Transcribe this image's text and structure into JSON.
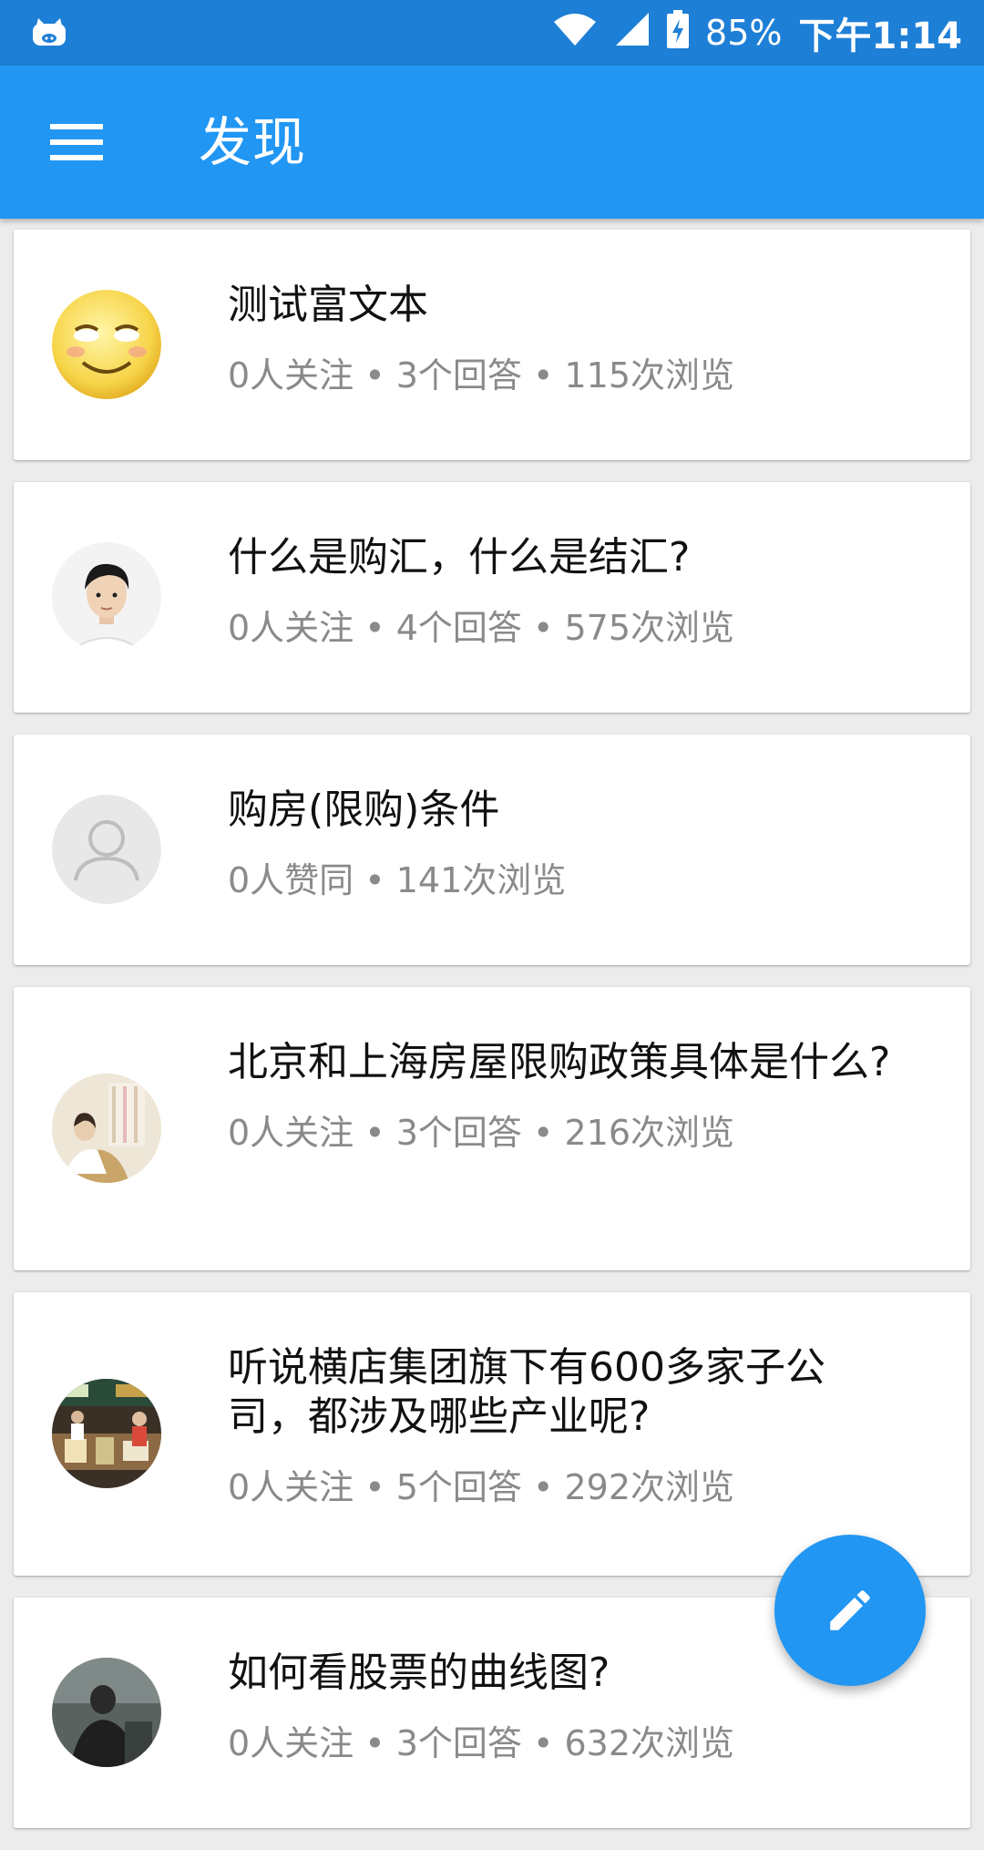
{
  "status_bar": {
    "battery": "85%",
    "time": "下午1:14"
  },
  "app_bar": {
    "title": "发现"
  },
  "questions": [
    {
      "title": "测试富文本",
      "meta": "0人关注 • 3个回答 • 115次浏览",
      "avatar": "smiley"
    },
    {
      "title": "什么是购汇，什么是结汇?",
      "meta": "0人关注 • 4个回答 • 575次浏览",
      "avatar": "person-photo"
    },
    {
      "title": "购房(限购)条件",
      "meta": "0人赞同 • 141次浏览",
      "avatar": "default-user"
    },
    {
      "title": "北京和上海房屋限购政策具体是什么?",
      "meta": "0人关注 • 3个回答 • 216次浏览",
      "avatar": "photo-light"
    },
    {
      "title": "听说横店集团旗下有600多家子公司，都涉及哪些产业呢?",
      "meta": "0人关注 • 5个回答 • 292次浏览",
      "avatar": "photo-store"
    },
    {
      "title": "如何看股票的曲线图?",
      "meta": "0人关注 • 3个回答 • 632次浏览",
      "avatar": "photo-dark"
    }
  ],
  "colors": {
    "primary": "#2196f3",
    "status_bar": "#1e7fd6"
  },
  "fab_icon": "pencil-icon"
}
